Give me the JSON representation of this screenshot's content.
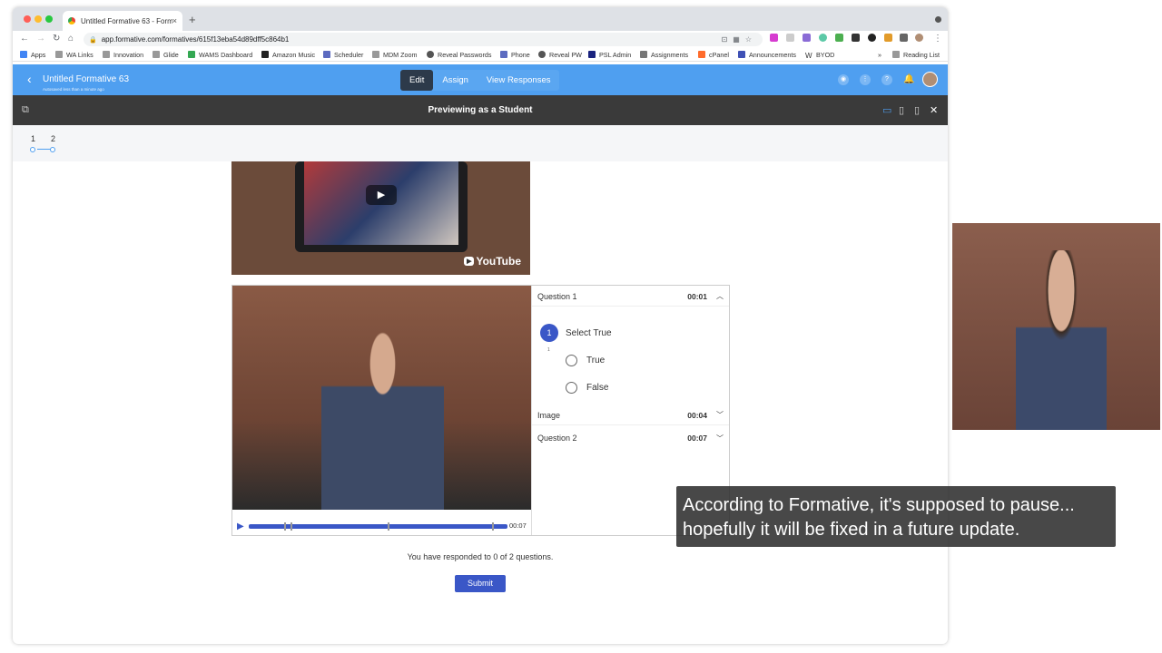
{
  "browser": {
    "tab_title": "Untitled Formative 63 - Forma",
    "tab_close": "×",
    "new_tab": "+",
    "url": "app.formative.com/formatives/615f13eba54d89dff5c864b1",
    "bookmarks": [
      "Apps",
      "WA Links",
      "Innovation",
      "Glide",
      "WAMS Dashboard",
      "Amazon Music",
      "Scheduler",
      "MDM Zoom",
      "Reveal Passwords",
      "Phone",
      "Reveal PW",
      "PSL Admin",
      "Assignments",
      "cPanel",
      "Announcements",
      "BYOD"
    ],
    "more": "»",
    "reading_list": "Reading List",
    "traffic": [
      "#ff5f57",
      "#febc2e",
      "#28c840"
    ]
  },
  "app": {
    "title": "Untitled Formative 63",
    "subtitle": "Autosaved less than a minute ago",
    "tabs": [
      "Edit",
      "Assign",
      "View Responses"
    ]
  },
  "preview": {
    "title": "Previewing as a Student"
  },
  "nav": {
    "pages": [
      "1",
      "2"
    ]
  },
  "video": {
    "youtube_label": "YouTube",
    "time": "00:07"
  },
  "questions": {
    "q1_label": "Question 1",
    "q1_time": "00:01",
    "number": "1",
    "prompt": "Select True",
    "small_number": "1",
    "options": [
      "True",
      "False"
    ],
    "image_label": "Image",
    "image_time": "00:04",
    "q2_label": "Question 2",
    "q2_time": "00:07"
  },
  "footer": {
    "responded": "You have responded to 0 of 2 questions.",
    "submit": "Submit"
  },
  "caption": {
    "line1": "According to Formative, it's supposed to pause...",
    "line2": "hopefully it will be fixed in a future update."
  }
}
